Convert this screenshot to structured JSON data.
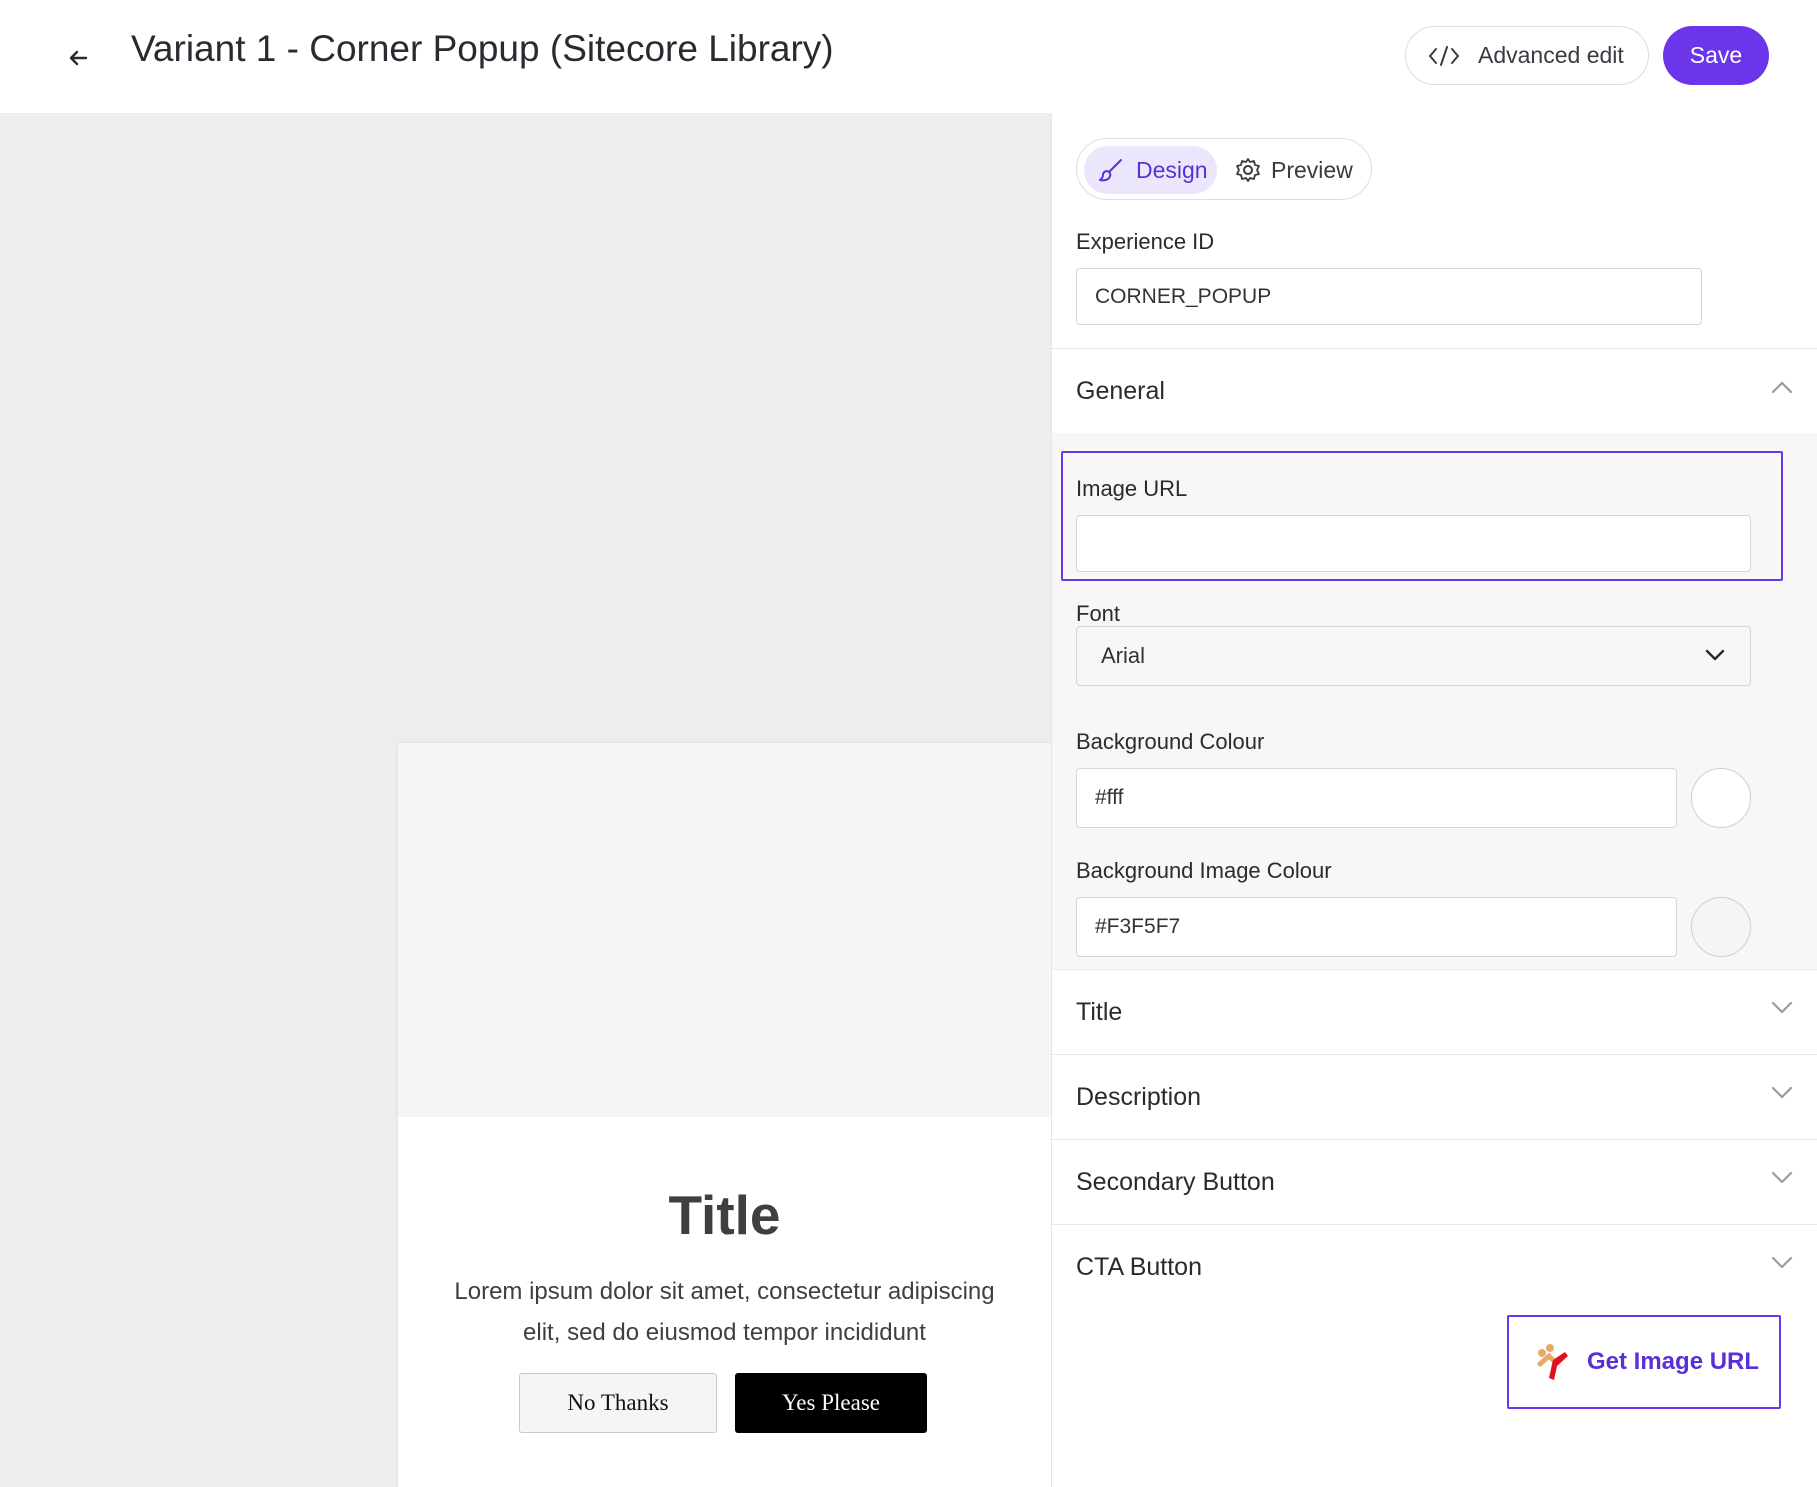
{
  "header": {
    "title": "Variant 1 - Corner Popup (Sitecore Library)",
    "advanced_edit_label": "Advanced edit",
    "save_label": "Save"
  },
  "tabs": [
    {
      "label": "Design",
      "icon": "brush-icon",
      "active": true
    },
    {
      "label": "Preview",
      "icon": "gear-icon",
      "active": false
    }
  ],
  "experience": {
    "label": "Experience ID",
    "value": "CORNER_POPUP"
  },
  "sections": {
    "general": {
      "label": "General",
      "expanded": true,
      "image_url": {
        "label": "Image URL",
        "value": ""
      },
      "font": {
        "label": "Font",
        "value": "Arial"
      },
      "background_colour": {
        "label": "Background Colour",
        "value": "#fff"
      },
      "background_image_colour": {
        "label": "Background Image Colour",
        "value": "#F3F5F7"
      }
    },
    "title": {
      "label": "Title"
    },
    "description": {
      "label": "Description"
    },
    "secondary_button": {
      "label": "Secondary Button"
    },
    "cta_button": {
      "label": "CTA Button"
    }
  },
  "get_image_url_label": "Get Image URL",
  "popup": {
    "title": "Title",
    "description": "Lorem ipsum dolor sit amet, consectetur adipiscing elit, sed do eiusmod tempor incididunt",
    "secondary_button": "No Thanks",
    "cta_button": "Yes Please"
  },
  "colors": {
    "accent": "#6b36e9",
    "canvas_bg": "#ededed",
    "popup_image_bg": "#F3F5F7"
  }
}
